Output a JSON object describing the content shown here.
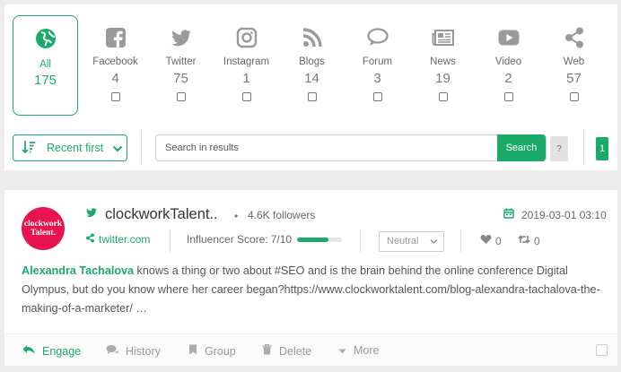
{
  "sources": [
    {
      "label": "All",
      "count": "175",
      "icon": "globe-icon",
      "active": true
    },
    {
      "label": "Facebook",
      "count": "4",
      "icon": "facebook-icon"
    },
    {
      "label": "Twitter",
      "count": "75",
      "icon": "twitter-icon"
    },
    {
      "label": "Instagram",
      "count": "1",
      "icon": "instagram-icon"
    },
    {
      "label": "Blogs",
      "count": "14",
      "icon": "rss-icon"
    },
    {
      "label": "Forum",
      "count": "3",
      "icon": "comments-icon"
    },
    {
      "label": "News",
      "count": "19",
      "icon": "newspaper-icon"
    },
    {
      "label": "Video",
      "count": "2",
      "icon": "youtube-icon"
    },
    {
      "label": "Web",
      "count": "57",
      "icon": "share-icon"
    }
  ],
  "toolbar": {
    "sort_label": "Recent first",
    "search_placeholder": "Search in results",
    "search_button": "Search",
    "help": "?",
    "page": "1"
  },
  "post": {
    "avatar_line1": "clockwork",
    "avatar_line2": "Talent.",
    "author": "clockworkTalent..",
    "followers": "4.6K  followers",
    "date": "2019-03-01 03:10",
    "source": "twitter.com",
    "influencer_label": "Influencer Score: ",
    "influencer_value": "7/10",
    "influencer_fraction": 0.7,
    "sentiment": "Neutral",
    "likes": "0",
    "shares": "0",
    "mention": "Alexandra Tachalova",
    "text": " knows a thing or two about #SEO and is the brain behind the online conference Digital Olympus, but do you know where her career began?https://www.clockworktalent.com/blog-alexandra-tachalova-the-making-of-a-marketer/ …"
  },
  "actions": {
    "engage": "Engage",
    "history": "History",
    "group": "Group",
    "delete": "Delete",
    "more": "More"
  },
  "colors": {
    "accent": "#1aaa6a",
    "icon_grey": "#9a9a9a",
    "avatar_bg": "#e8144f"
  }
}
